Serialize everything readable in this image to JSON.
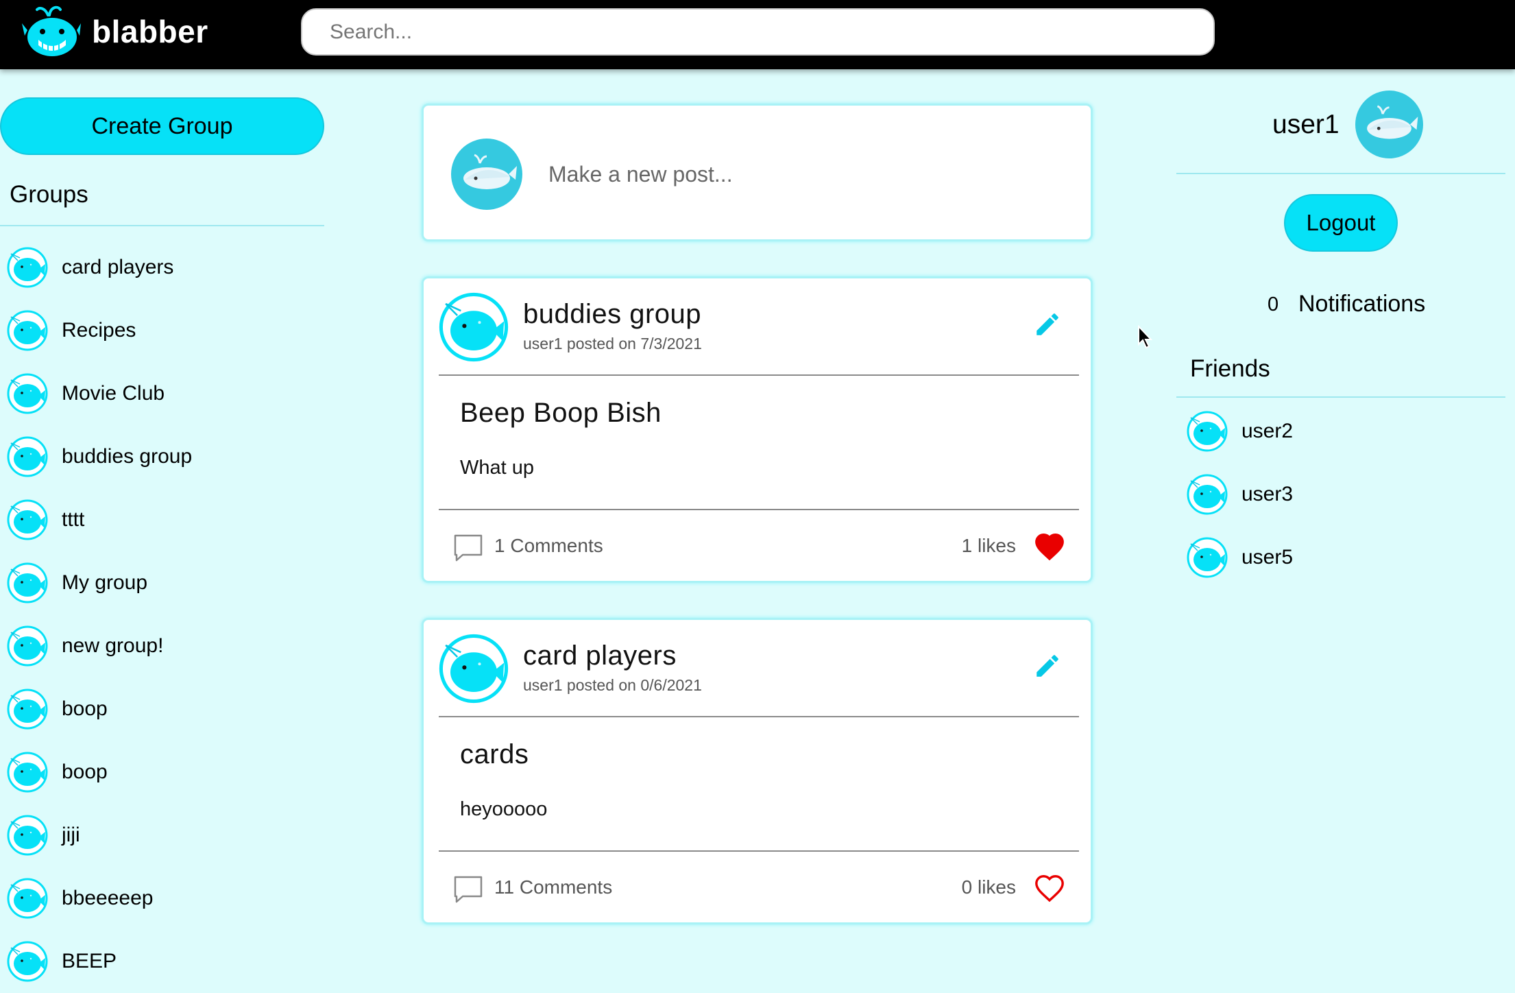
{
  "app": {
    "brand": "blabber",
    "accent_color": "#06e1f7",
    "background_color": "#ddfcfc"
  },
  "search": {
    "placeholder": "Search..."
  },
  "left": {
    "create_group_label": "Create Group",
    "groups_title": "Groups",
    "groups": [
      {
        "name": "card players"
      },
      {
        "name": "Recipes"
      },
      {
        "name": "Movie Club"
      },
      {
        "name": "buddies group"
      },
      {
        "name": "tttt"
      },
      {
        "name": "My group"
      },
      {
        "name": "new group!"
      },
      {
        "name": "boop"
      },
      {
        "name": "boop"
      },
      {
        "name": "jiji"
      },
      {
        "name": "bbeeeeep"
      },
      {
        "name": "BEEP"
      }
    ]
  },
  "new_post": {
    "prompt": "Make a new post..."
  },
  "posts": [
    {
      "group": "buddies group",
      "meta": "user1 posted on 7/3/2021",
      "title": "Beep Boop Bish",
      "body": "What up",
      "comments": "1 Comments",
      "likes": "1 likes",
      "liked": true
    },
    {
      "group": "card players",
      "meta": "user1 posted on 0/6/2021",
      "title": "cards",
      "body": "heyooooo",
      "comments": "11 Comments",
      "likes": "0 likes",
      "liked": false
    }
  ],
  "right": {
    "username": "user1",
    "logout_label": "Logout",
    "notification_count": "0",
    "notifications_label": "Notifications",
    "friends_title": "Friends",
    "friends": [
      {
        "name": "user2"
      },
      {
        "name": "user3"
      },
      {
        "name": "user5"
      }
    ]
  },
  "icons": {
    "logo": "whale-logo-icon",
    "group": "narwhal-icon",
    "user_avatar": "whale-avatar-icon",
    "edit": "pencil-icon",
    "comment": "comment-icon",
    "like": "heart-icon"
  },
  "colors": {
    "heart": "#e90000",
    "pencil": "#06c8e6"
  }
}
